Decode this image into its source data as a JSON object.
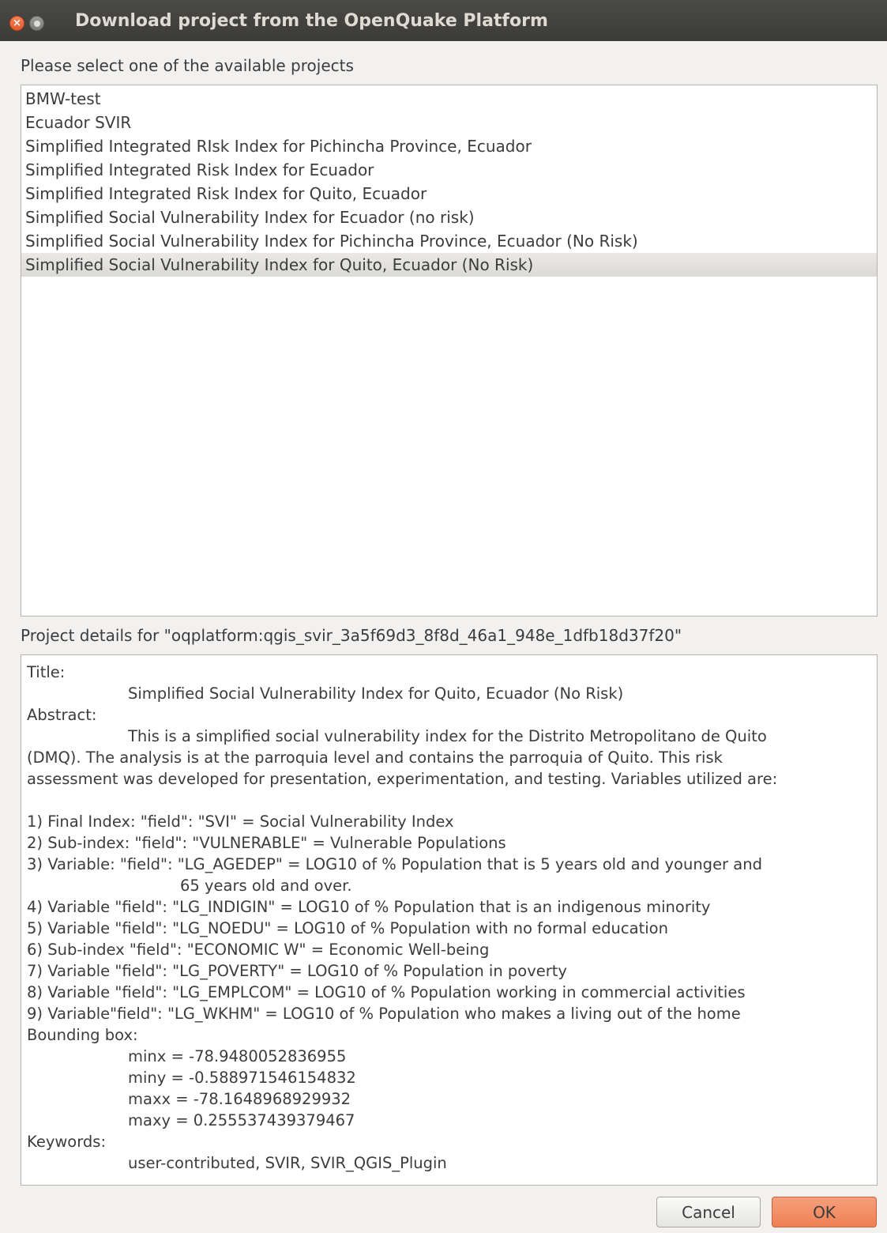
{
  "window": {
    "title": "Download project from the OpenQuake Platform",
    "close_icon": "close-icon",
    "minimize_icon": "minimize-icon"
  },
  "projects": {
    "prompt": "Please select one of the available projects",
    "items": [
      "BMW-test",
      "Ecuador SVIR",
      "Simplified Integrated RIsk Index for Pichincha Province, Ecuador",
      "Simplified Integrated Risk Index for Ecuador",
      "Simplified Integrated Risk Index for Quito, Ecuador",
      "Simplified Social Vulnerability Index for Ecuador (no risk)",
      "Simplified Social Vulnerability Index for Pichincha Province, Ecuador (No Risk)",
      "Simplified Social Vulnerability Index for Quito, Ecuador (No Risk)"
    ],
    "selected_index": 7
  },
  "details": {
    "header": "Project details for \"oqplatform:qgis_svir_3a5f69d3_8f8d_46a1_948e_1dfb18d37f20\"",
    "title_label": "Title:",
    "title_value": "Simplified Social Vulnerability Index for Quito, Ecuador (No Risk)",
    "abstract_label": "Abstract:",
    "abstract_first": "This is a simplified social vulnerability index for the Distrito Metropolitano de Quito",
    "abstract_rest_1": "(DMQ). The analysis is at the parroquia level and contains the parroquia of Quito. This risk",
    "abstract_rest_2": "assessment was developed for presentation, experimentation, and testing. Variables utilized are:",
    "variables": [
      "1) Final Index: \"field\": \"SVI\" = Social Vulnerability Index",
      "2) Sub-index: \"field\": \"VULNERABLE\" = Vulnerable Populations",
      "3) Variable: \"field\": \"LG_AGEDEP\" = LOG10 of % Population that is 5 years old and younger and",
      "65 years old and over.",
      "4) Variable \"field\": \"LG_INDIGIN\" = LOG10 of % Population that is an indigenous minority",
      "5) Variable \"field\": \"LG_NOEDU\" = LOG10 of % Population with no formal education",
      "6) Sub-index \"field\": \"ECONOMIC W\" = Economic Well-being",
      "7) Variable \"field\": \"LG_POVERTY\" = LOG10 of % Population in poverty",
      "8) Variable \"field\": \"LG_EMPLCOM\" = LOG10 of % Population working in commercial activities",
      "9) Variable\"field\": \"LG_WKHM\" = LOG10 of % Population who makes a living out of the home"
    ],
    "bbox_label": "Bounding box:",
    "bbox": [
      "minx = -78.9480052836955",
      "miny = -0.588971546154832",
      "maxx = -78.1648968929932",
      "maxy = 0.255537439379467"
    ],
    "keywords_label": "Keywords:",
    "keywords_value": "user-contributed, SVIR, SVIR_QGIS_Plugin"
  },
  "buttons": {
    "cancel_label": "Cancel",
    "ok_label": "OK"
  },
  "colors": {
    "titlebar": "#3c3b37",
    "ok_accent": "#ef8052",
    "selection": "#dcdad7"
  }
}
